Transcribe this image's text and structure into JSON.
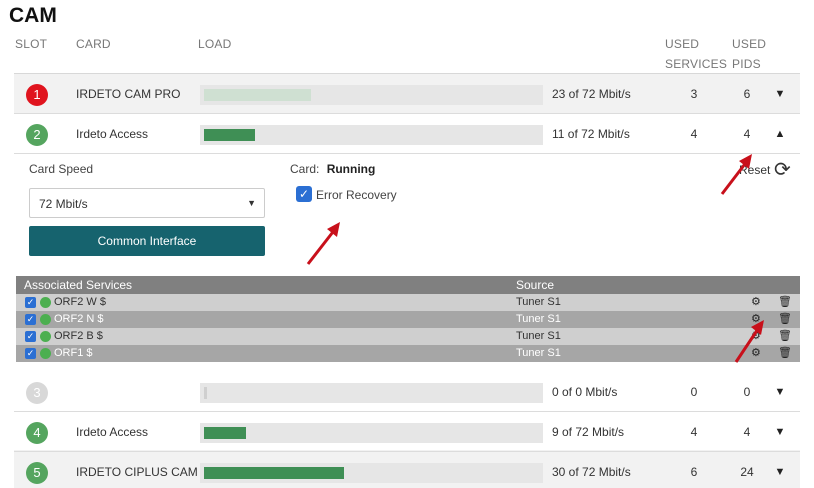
{
  "page": {
    "title": "CAM"
  },
  "columns": {
    "slot": "SLOT",
    "card": "CARD",
    "load": "LOAD",
    "used_services_1": "USED",
    "used_services_2": "SERVICES",
    "used_pids_1": "USED",
    "used_pids_2": "PIDS"
  },
  "slots": [
    {
      "slot": "1",
      "card": "IRDETO CAM PRO",
      "load_text": "23 of 72 Mbit/s",
      "load_fraction": 0.319,
      "services": "3",
      "pids": "6",
      "status_color": "#e0141e",
      "fill_color": "#cfe0d2",
      "chevron": "down"
    },
    {
      "slot": "2",
      "card": "Irdeto Access",
      "load_text": "11 of 72 Mbit/s",
      "load_fraction": 0.153,
      "services": "4",
      "pids": "4",
      "status_color": "#55a55f",
      "fill_color": "#3f8f55",
      "chevron": "up"
    },
    {
      "slot": "3",
      "card": "",
      "load_text": "0 of 0 Mbit/s",
      "load_fraction": 0.0,
      "services": "0",
      "pids": "0",
      "status_color": "#d8d8d8",
      "fill_color": "#cfcfcf",
      "chevron": "down"
    },
    {
      "slot": "4",
      "card": "Irdeto Access",
      "load_text": "9 of 72 Mbit/s",
      "load_fraction": 0.125,
      "services": "4",
      "pids": "4",
      "status_color": "#55a55f",
      "fill_color": "#3f8f55",
      "chevron": "down"
    },
    {
      "slot": "5",
      "card": "IRDETO CIPLUS CAM",
      "load_text": "30 of 72 Mbit/s",
      "load_fraction": 0.417,
      "services": "6",
      "pids": "24",
      "status_color": "#55a55f",
      "fill_color": "#3f8f55",
      "chevron": "down"
    }
  ],
  "details": {
    "card_speed_label": "Card Speed",
    "card_speed_value": "72 Mbit/s",
    "card_status_label": "Card:",
    "card_status_value": "Running",
    "error_recovery_label": "Error Recovery",
    "error_recovery_checked": true,
    "reset_label": "Reset",
    "common_interface_label": "Common Interface"
  },
  "associated_services": {
    "header_label": "Associated Services",
    "source_label": "Source",
    "rows": [
      {
        "name": "ORF2 W $",
        "source": "Tuner S1",
        "checked": true
      },
      {
        "name": "ORF2 N $",
        "source": "Tuner S1",
        "checked": true
      },
      {
        "name": "ORF2 B $",
        "source": "Tuner S1",
        "checked": true
      },
      {
        "name": "ORF1 $",
        "source": "Tuner S1",
        "checked": true
      }
    ]
  },
  "icons": {
    "chevron_down": "chevron-down-icon",
    "chevron_up": "chevron-up-icon",
    "reset": "refresh-icon",
    "gear": "gear-icon",
    "trash": "trash-icon",
    "annotation": "red-arrow-icon"
  },
  "colors": {
    "accent_button": "#16636e",
    "checkbox": "#2b6fd3",
    "service_dot": "#4caf50",
    "annotation_arrow": "#c8101b"
  }
}
